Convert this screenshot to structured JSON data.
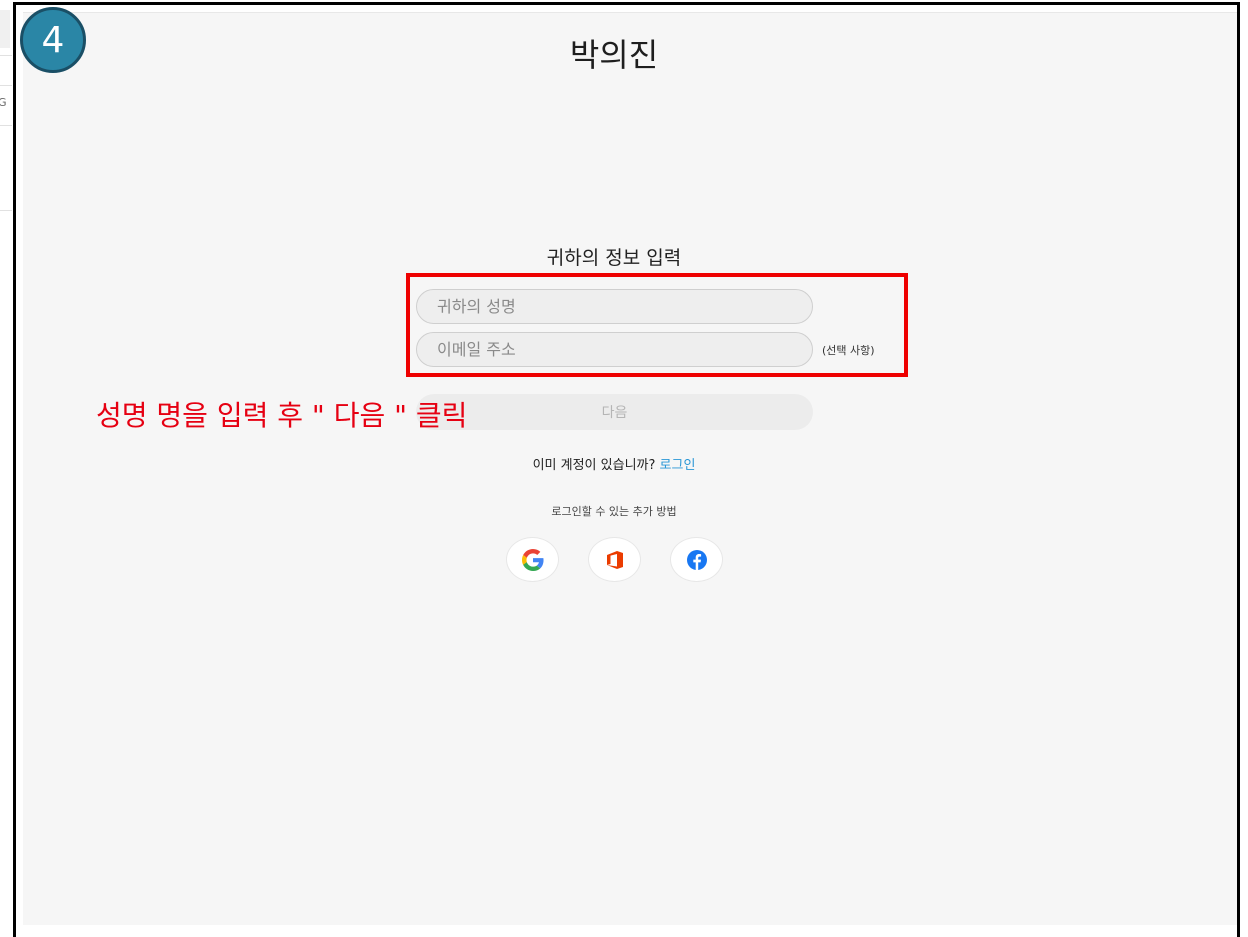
{
  "step_badge": "4",
  "page_title": "박의진",
  "form": {
    "heading": "귀하의 정보 입력",
    "name_placeholder": "귀하의 성명",
    "email_placeholder": "이메일 주소",
    "optional_note": "(선택 사항)",
    "next_label": "다음"
  },
  "annotation": "성명 명을 입력 후 \" 다음 \" 클릭",
  "login": {
    "prompt": "이미 계정이 있습니까?",
    "link_label": "로그인"
  },
  "other_ways": "로그인할 수 있는 추가 방법",
  "social_buttons": [
    {
      "icon": "google-icon"
    },
    {
      "icon": "office-icon"
    },
    {
      "icon": "facebook-icon"
    }
  ],
  "left_strip_char": "G",
  "colors": {
    "annotation": "#e60012",
    "highlight_box": "#ee0000",
    "badge": "#2a86a6",
    "link": "#2a97d6",
    "facebook": "#1877f2",
    "office": "#eb3c00"
  }
}
